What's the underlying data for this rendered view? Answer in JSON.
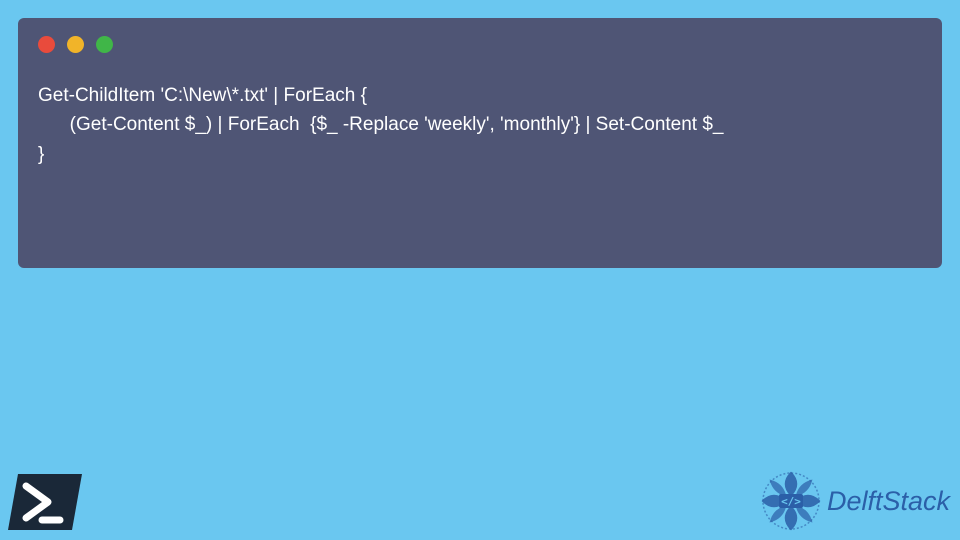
{
  "window": {
    "controls": {
      "close_color": "#e94b3c",
      "minimize_color": "#f1b429",
      "maximize_color": "#40b648"
    }
  },
  "code": {
    "line1": "Get-ChildItem 'C:\\New\\*.txt' | ForEach {",
    "line2": "      (Get-Content $_) | ForEach  {$_ -Replace 'weekly', 'monthly'} | Set-Content $_",
    "line3": "}"
  },
  "branding": {
    "powershell_icon": "powershell-icon",
    "logo_text": "DelftStack",
    "logo_color": "#2b5fa8"
  }
}
